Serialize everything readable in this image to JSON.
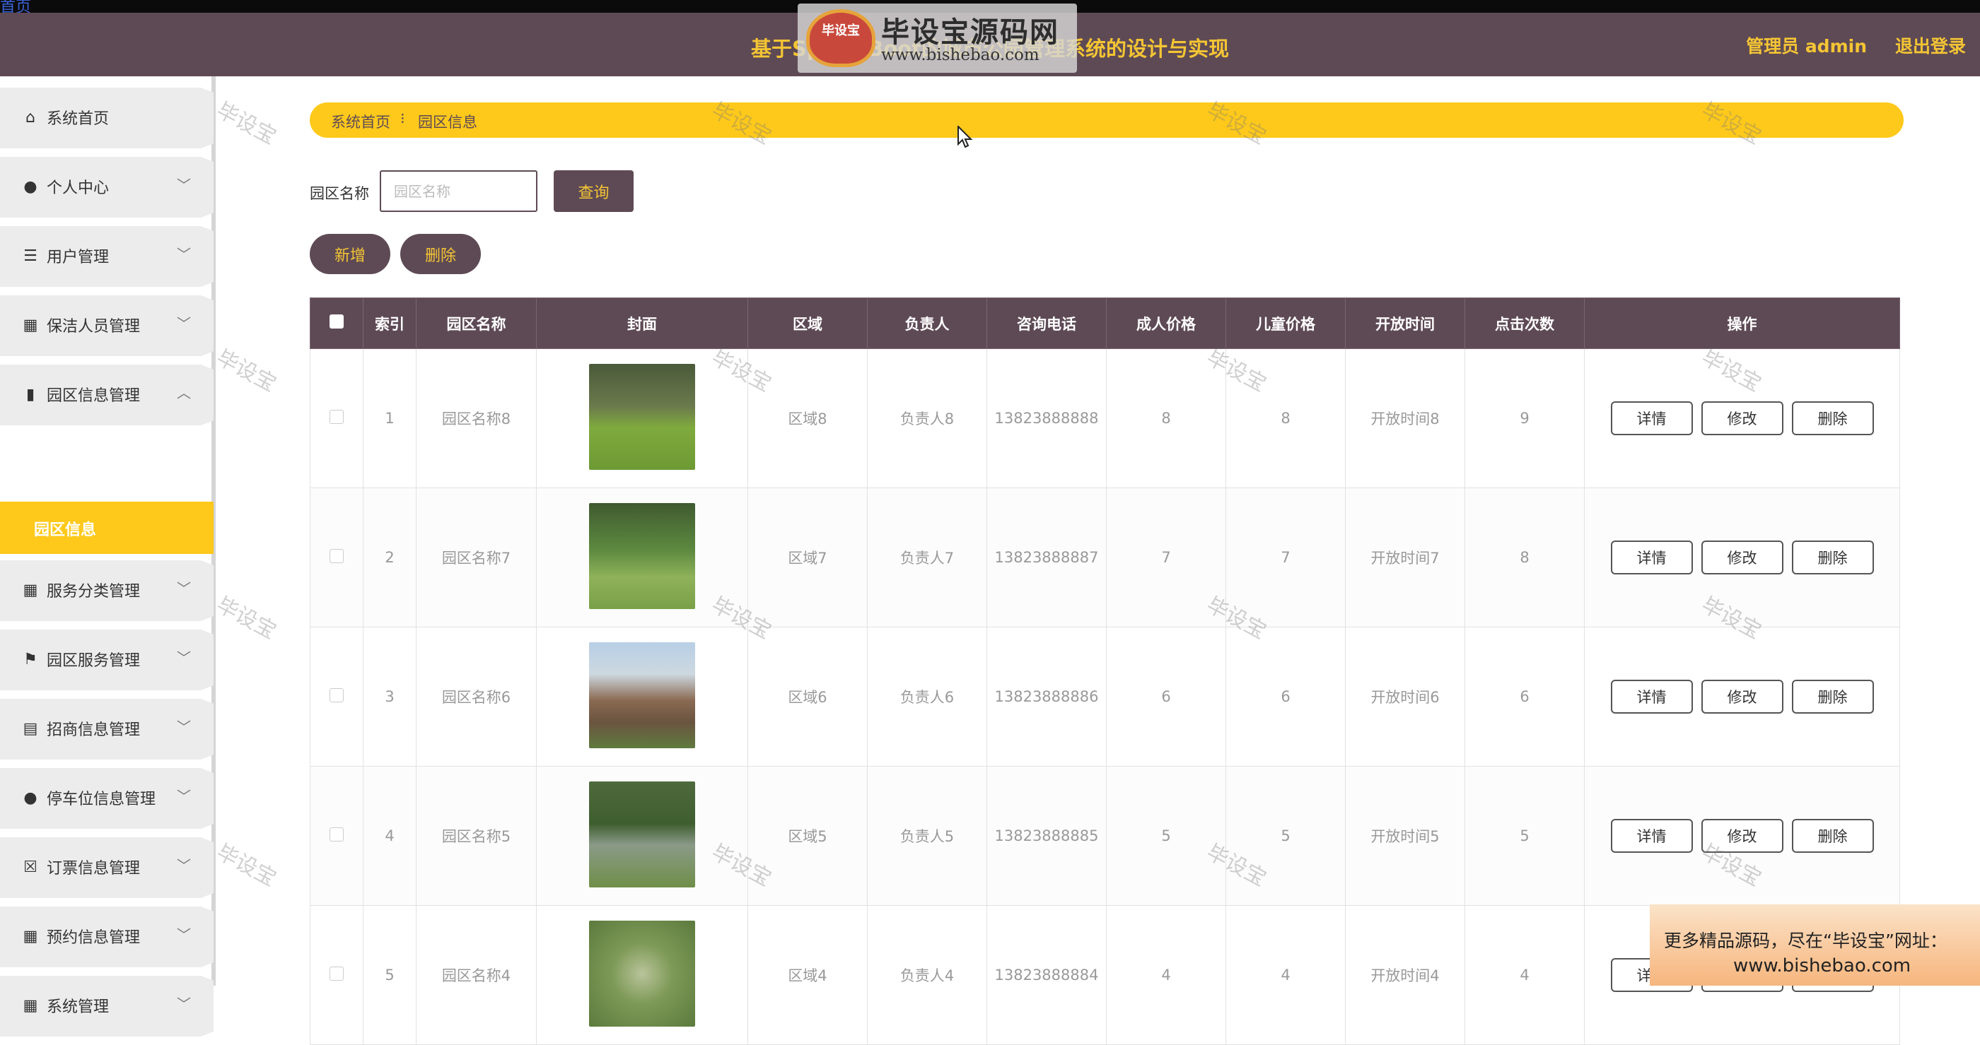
{
  "topbar": {
    "link_text": "首页"
  },
  "header": {
    "title": "基于SpringBoot的城市公园管理系统的设计与实现",
    "user": "管理员 admin",
    "logout": "退出登录"
  },
  "brand": {
    "logo_text": "毕设宝",
    "name": "毕设宝源码网",
    "url": "www.bishebao.com"
  },
  "sidebar": {
    "items": [
      {
        "label": "系统首页",
        "icon": "home-icon",
        "glyph": "⌂",
        "chevron": ""
      },
      {
        "label": "个人中心",
        "icon": "user-icon",
        "glyph": "●",
        "chevron": "﹀"
      },
      {
        "label": "用户管理",
        "icon": "list-icon",
        "glyph": "☰",
        "chevron": "﹀"
      },
      {
        "label": "保洁人员管理",
        "icon": "grid-icon",
        "glyph": "▦",
        "chevron": "﹀"
      },
      {
        "label": "园区信息管理",
        "icon": "bar-chart-icon",
        "glyph": "▮",
        "chevron": "︿"
      },
      {
        "label": "服务分类管理",
        "icon": "grid-icon",
        "glyph": "▦",
        "chevron": "﹀"
      },
      {
        "label": "园区服务管理",
        "icon": "flag-icon",
        "glyph": "⚑",
        "chevron": "﹀"
      },
      {
        "label": "招商信息管理",
        "icon": "clipboard-icon",
        "glyph": "▤",
        "chevron": "﹀"
      },
      {
        "label": "停车位信息管理",
        "icon": "user-icon",
        "glyph": "●",
        "chevron": "﹀"
      },
      {
        "label": "订票信息管理",
        "icon": "ticket-icon",
        "glyph": "☒",
        "chevron": "﹀"
      },
      {
        "label": "预约信息管理",
        "icon": "grid-icon",
        "glyph": "▦",
        "chevron": "﹀"
      },
      {
        "label": "系统管理",
        "icon": "grid-icon",
        "glyph": "▦",
        "chevron": "﹀"
      }
    ],
    "active_sub": "园区信息"
  },
  "breadcrumb": {
    "home": "系统首页",
    "sep": "⁝",
    "current": "园区信息"
  },
  "search": {
    "label": "园区名称",
    "placeholder": "园区名称",
    "query_btn": "查询"
  },
  "actions": {
    "add": "新增",
    "delete": "删除"
  },
  "table": {
    "headers": [
      "索引",
      "园区名称",
      "封面",
      "区域",
      "负责人",
      "咨询电话",
      "成人价格",
      "儿童价格",
      "开放时间",
      "点击次数",
      "操作"
    ],
    "row_actions": {
      "detail": "详情",
      "edit": "修改",
      "delete": "删除"
    },
    "rows": [
      {
        "index": "1",
        "name": "园区名称8",
        "area": "区域8",
        "manager": "负责人8",
        "phone": "13823888888",
        "adult": "8",
        "child": "8",
        "open": "开放时间8",
        "clicks": "9"
      },
      {
        "index": "2",
        "name": "园区名称7",
        "area": "区域7",
        "manager": "负责人7",
        "phone": "13823888887",
        "adult": "7",
        "child": "7",
        "open": "开放时间7",
        "clicks": "8"
      },
      {
        "index": "3",
        "name": "园区名称6",
        "area": "区域6",
        "manager": "负责人6",
        "phone": "13823888886",
        "adult": "6",
        "child": "6",
        "open": "开放时间6",
        "clicks": "6"
      },
      {
        "index": "4",
        "name": "园区名称5",
        "area": "区域5",
        "manager": "负责人5",
        "phone": "13823888885",
        "adult": "5",
        "child": "5",
        "open": "开放时间5",
        "clicks": "5"
      },
      {
        "index": "5",
        "name": "园区名称4",
        "area": "区域4",
        "manager": "负责人4",
        "phone": "13823888884",
        "adult": "4",
        "child": "4",
        "open": "开放时间4",
        "clicks": "4"
      }
    ]
  },
  "watermark": "毕设宝",
  "promo": {
    "line1": "更多精品源码，尽在“毕设宝”网址：",
    "line2": "www.bishebao.com"
  },
  "colors": {
    "primary": "#5e4a55",
    "accent": "#fec91b",
    "header_text": "#f4c534"
  }
}
